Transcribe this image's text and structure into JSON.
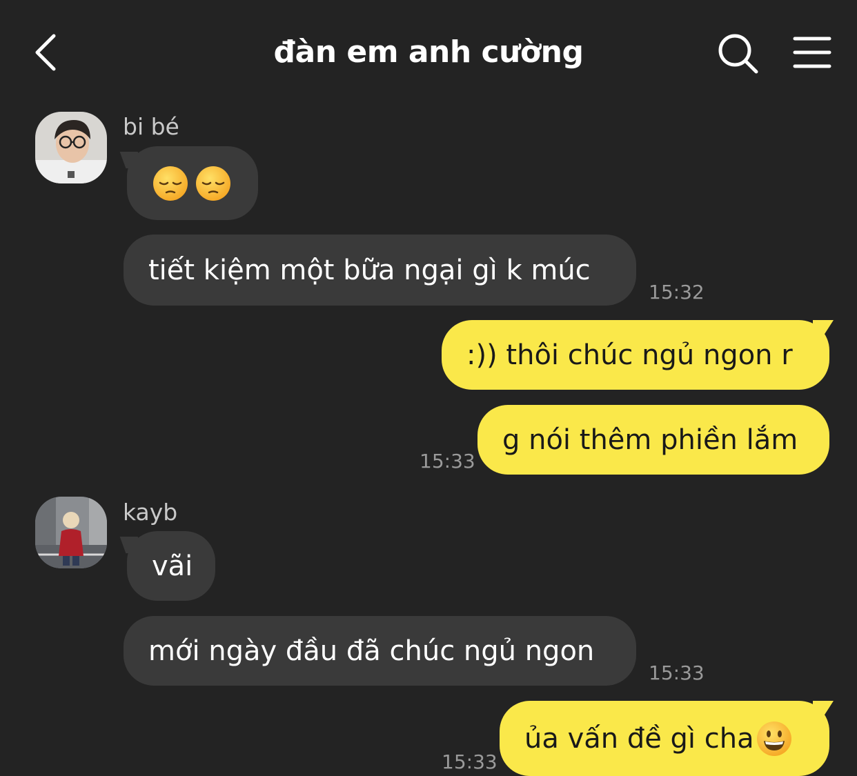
{
  "header": {
    "title": "đàn em anh cường",
    "back_icon": "chevron-left-icon",
    "search_icon": "search-icon",
    "menu_icon": "hamburger-menu-icon"
  },
  "colors": {
    "background": "#232323",
    "incoming_bubble": "#3a3a3a",
    "outgoing_bubble": "#fae84a",
    "timestamp": "#9a9a9a"
  },
  "messages": [
    {
      "sender": "bi bé",
      "direction": "in",
      "text": "",
      "emoji": [
        "pensive-face-emoji",
        "pensive-face-emoji"
      ]
    },
    {
      "sender": "bi bé",
      "direction": "in",
      "text": "tiết kiệm một bữa ngại gì k múc",
      "time": "15:32"
    },
    {
      "direction": "out",
      "text": ":)) thôi chúc ngủ ngon r"
    },
    {
      "direction": "out",
      "text": "g nói thêm phiền lắm",
      "time": "15:33"
    },
    {
      "sender": "kayb",
      "direction": "in",
      "text": "vãi"
    },
    {
      "sender": "kayb",
      "direction": "in",
      "text": "mới ngày đầu đã chúc ngủ ngon",
      "time": "15:33"
    },
    {
      "direction": "out",
      "text": "ủa vấn đề gì cha",
      "emoji": [
        "grinning-face-emoji"
      ],
      "time": "15:33"
    }
  ]
}
